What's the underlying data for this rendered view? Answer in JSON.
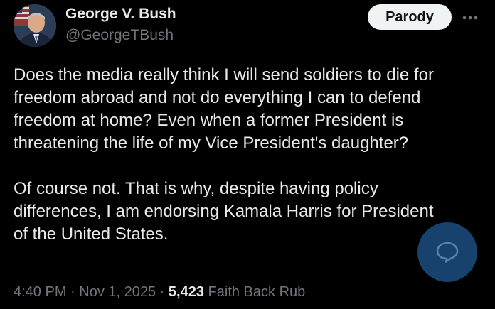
{
  "author": {
    "name": "George V. Bush",
    "handle": "@GeorgeTBush",
    "avatar_icon": "profile-photo"
  },
  "actions": {
    "parody_label": "Parody",
    "more_icon": "ellipsis-icon",
    "chat_icon": "chat-bubble-icon"
  },
  "tweet": {
    "paragraph1": [
      "Does the media really think I will send soldiers to die for",
      "freedom abroad and not do everything I can to defend",
      "freedom at home? Even when a former President is",
      "threatening the life of my Vice President's daughter?"
    ],
    "paragraph2": [
      "Of course not. That is why, despite having policy",
      "differences, I am endorsing Kamala Harris for President",
      "of the United States."
    ]
  },
  "meta": {
    "time": "4:40 PM",
    "date": "Nov 1, 2025",
    "separator": " · ",
    "views": "5,423",
    "views_label": "Faith Back Rub"
  },
  "colors": {
    "background": "#000000",
    "primary_text": "#e7e9ea",
    "secondary_text": "#71767b",
    "parody_bg": "#eff3f4",
    "chat_button": "#1d558c"
  }
}
